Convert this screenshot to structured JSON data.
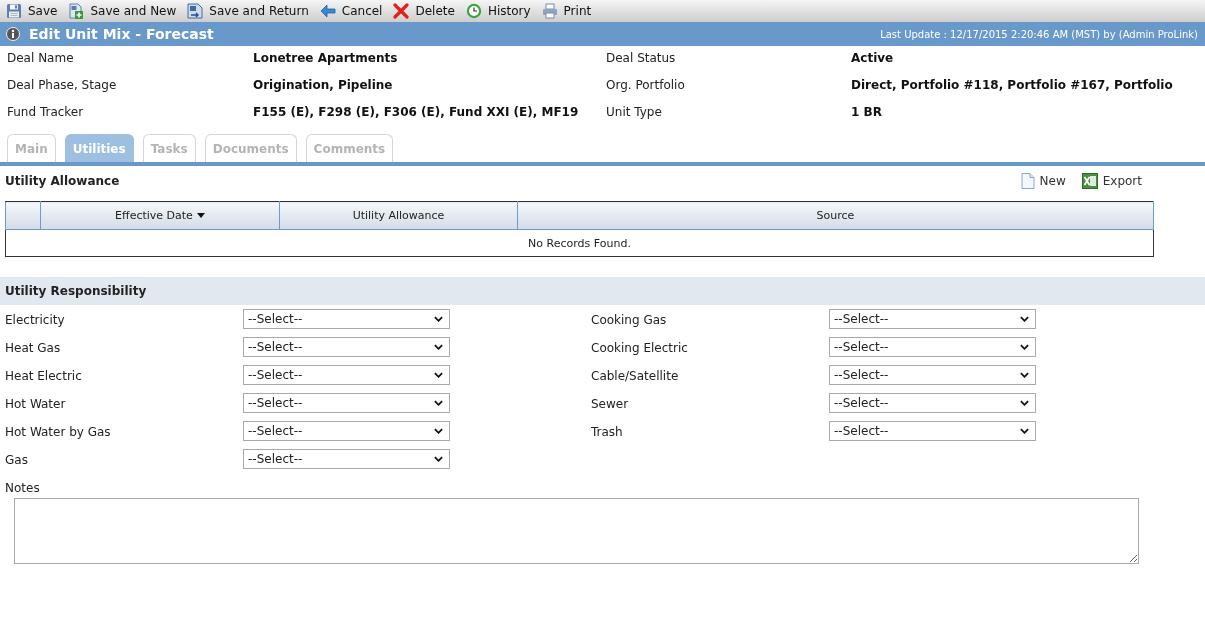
{
  "toolbar": [
    {
      "kind": "save",
      "label": "Save"
    },
    {
      "kind": "savenew",
      "label": "Save and New"
    },
    {
      "kind": "savereturn",
      "label": "Save and Return"
    },
    {
      "kind": "cancel",
      "label": "Cancel"
    },
    {
      "kind": "delete",
      "label": "Delete"
    },
    {
      "kind": "history",
      "label": "History"
    },
    {
      "kind": "print",
      "label": "Print"
    }
  ],
  "title_bar": {
    "title": "Edit Unit Mix - Forecast",
    "last_update": "Last Update : 12/17/2015 2:20:46 AM (MST) by (Admin ProLink)"
  },
  "deal_info": [
    {
      "label": "Deal Name",
      "value": "Lonetree Apartments"
    },
    {
      "label": "Deal Status",
      "value": "Active"
    },
    {
      "label": "Deal Phase, Stage",
      "value": "Origination, Pipeline"
    },
    {
      "label": "Org. Portfolio",
      "value": "Direct, Portfolio #118, Portfolio #167, Portfolio"
    },
    {
      "label": "Fund Tracker",
      "value": "F155 (E), F298 (E), F306 (E), Fund XXI (E), MF19"
    },
    {
      "label": "Unit Type",
      "value": "1 BR"
    }
  ],
  "tabs": [
    {
      "label": "Main",
      "selected": false
    },
    {
      "label": "Utilities",
      "selected": true
    },
    {
      "label": "Tasks",
      "selected": false
    },
    {
      "label": "Documents",
      "selected": false
    },
    {
      "label": "Comments",
      "selected": false
    }
  ],
  "utility_allowance": {
    "title": "Utility Allowance",
    "actions": [
      {
        "kind": "new",
        "label": "New"
      },
      {
        "kind": "export",
        "label": "Export"
      }
    ],
    "table": {
      "columns": [
        {
          "label": "Effective Date",
          "sorted": true
        },
        {
          "label": "Utility Allowance",
          "sorted": false
        },
        {
          "label": "Source",
          "sorted": false
        }
      ],
      "empty_message": "No Records Found."
    }
  },
  "utility_responsibility": {
    "title": "Utility Responsibility",
    "fields": [
      {
        "label": "Electricity",
        "value": "--Select--"
      },
      {
        "label": "Cooking Gas",
        "value": "--Select--"
      },
      {
        "label": "Heat Gas",
        "value": "--Select--"
      },
      {
        "label": "Cooking Electric",
        "value": "--Select--"
      },
      {
        "label": "Heat Electric",
        "value": "--Select--"
      },
      {
        "label": "Cable/Satellite",
        "value": "--Select--"
      },
      {
        "label": "Hot Water",
        "value": "--Select--"
      },
      {
        "label": "Sewer",
        "value": "--Select--"
      },
      {
        "label": "Hot Water by Gas",
        "value": "--Select--"
      },
      {
        "label": "Trash",
        "value": "--Select--"
      },
      {
        "label": "Gas",
        "value": "--Select--"
      }
    ]
  },
  "notes": {
    "label": "Notes"
  }
}
